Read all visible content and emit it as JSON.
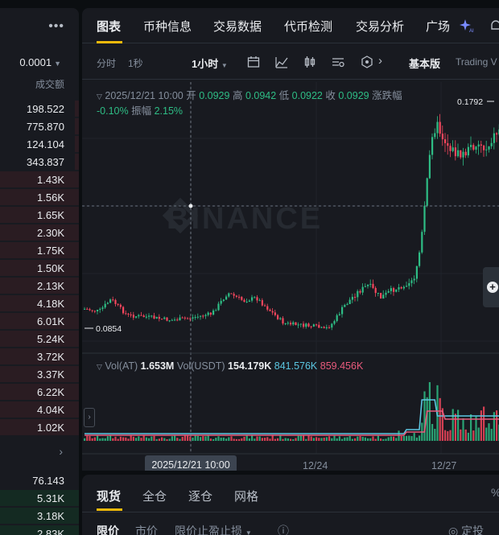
{
  "orderbook": {
    "more_icon": "more-dots-icon",
    "step": "0.0001",
    "column_header": "成交额",
    "asks": [
      "198.522",
      "775.870",
      "124.104",
      "343.837",
      "1.43K",
      "1.56K",
      "1.65K",
      "2.30K",
      "1.75K",
      "1.50K",
      "2.13K",
      "4.18K",
      "6.01K",
      "5.24K",
      "3.72K",
      "3.37K",
      "6.22K",
      "4.04K",
      "1.02K"
    ],
    "ask_depth": [
      0.05,
      0.05,
      0.05,
      0.05,
      1,
      1,
      1,
      1,
      1,
      1,
      1,
      1,
      1,
      1,
      1,
      1,
      1,
      1,
      1
    ],
    "bids": [
      "76.143",
      "5.31K",
      "3.18K",
      "2.83K"
    ],
    "bid_depth": [
      0,
      1,
      1,
      1
    ]
  },
  "tabs": {
    "items": [
      "图表",
      "币种信息",
      "交易数据",
      "代币检测",
      "交易分析",
      "广场"
    ],
    "active": "图表"
  },
  "toolbar": {
    "time_items": [
      "分时",
      "1秒"
    ],
    "interval": "1小时",
    "version": "基本版",
    "trading_view": "Trading V"
  },
  "ohlc": {
    "datetime": "2025/12/21 10:00",
    "open_label": "开",
    "open": "0.0929",
    "high_label": "高",
    "high": "0.0942",
    "low_label": "低",
    "low": "0.0922",
    "close_label": "收",
    "close": "0.0929",
    "change_label": "涨跌幅",
    "change": "-0.10%",
    "amp_label": "振幅",
    "amp": "2.15%"
  },
  "volume": {
    "label_at": "Vol(AT)",
    "value_at": "1.653M",
    "label_usdt": "Vol(USDT)",
    "value_usdt": "154.179K",
    "ma1": "841.576K",
    "ma2": "859.456K"
  },
  "chart": {
    "watermark": "BINANCE",
    "high_marker": "0.1792",
    "low_marker": "0.0854",
    "crosshair_label": "2025/12/21 10:00",
    "x_labels": [
      "12/24",
      "12/27"
    ],
    "colors": {
      "up": "#2ebd85",
      "down": "#f6465d",
      "accent": "#f0b90b"
    }
  },
  "trade": {
    "tabs": [
      "现货",
      "全仓",
      "逐仓",
      "网格"
    ],
    "order_types": [
      "限价",
      "市价",
      "限价止盈止损"
    ],
    "dca": "定投"
  }
}
